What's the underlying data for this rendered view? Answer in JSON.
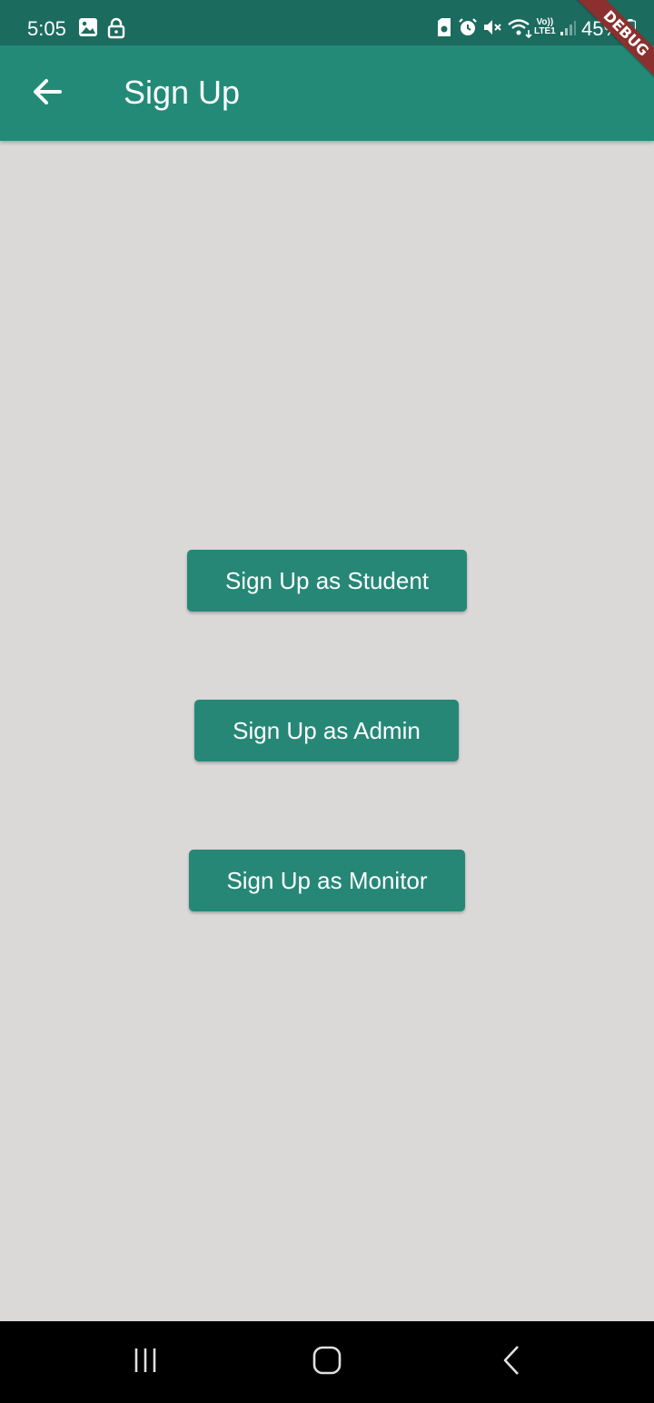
{
  "status_bar": {
    "time": "5:05",
    "battery": "45%",
    "icons": [
      "gallery-icon",
      "lock-icon",
      "sim-icon",
      "alarm-icon",
      "mute-icon",
      "wifi-icon",
      "volte-icon",
      "signal-icon",
      "battery-icon"
    ],
    "volte_line1": "Vo))",
    "volte_line2": "LTE1"
  },
  "debug_banner": "DEBUG",
  "app_bar": {
    "title": "Sign Up",
    "back_icon": "arrow-back-icon",
    "color": "#238a78"
  },
  "buttons": {
    "student": "Sign Up as Student",
    "admin": "Sign Up as Admin",
    "monitor": "Sign Up as Monitor",
    "color": "#268777"
  },
  "nav_bar": {
    "icons": [
      "recent-apps-icon",
      "home-icon",
      "back-icon"
    ]
  },
  "colors": {
    "background": "#dad9d8",
    "status_bar": "#1c6b5f"
  }
}
